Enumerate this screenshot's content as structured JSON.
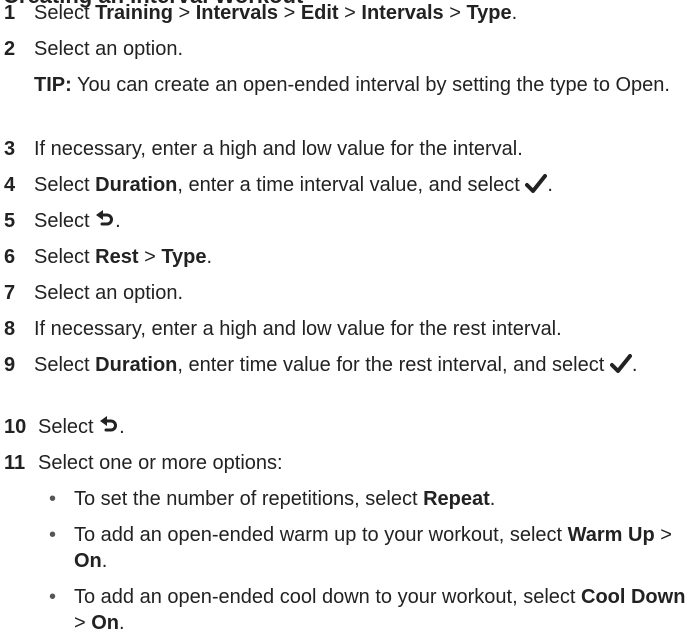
{
  "heading": "Creating an Interval Workout",
  "tip": {
    "label": "TIP:",
    "text": " You can create an open-ended interval by setting the type to Open."
  },
  "steps": {
    "s1": {
      "num": "1",
      "pre": "Select ",
      "b1": "Training",
      "sep1": " > ",
      "b2": "Intervals",
      "sep2": " > ",
      "b3": "Edit",
      "sep3": " > ",
      "b4": "Intervals",
      "sep4": " > ",
      "b5": "Type",
      "post": "."
    },
    "s2": {
      "num": "2",
      "text": "Select an option."
    },
    "s3": {
      "num": "3",
      "text": "If necessary, enter a high and low value for the interval."
    },
    "s4": {
      "num": "4",
      "pre": "Select ",
      "b1": "Duration",
      "post": ", enter a time interval value, and select ",
      "end": "."
    },
    "s5": {
      "num": "5",
      "pre": "Select ",
      "end": "."
    },
    "s6": {
      "num": "6",
      "pre": "Select ",
      "b1": "Rest",
      "sep1": " > ",
      "b2": "Type",
      "post": "."
    },
    "s7": {
      "num": "7",
      "text": "Select an option."
    },
    "s8": {
      "num": "8",
      "text": "If necessary, enter a high and low value for the rest interval."
    },
    "s9": {
      "num": "9",
      "pre": "Select ",
      "b1": "Duration",
      "post": ", enter time value for the rest interval, and select ",
      "end": "."
    },
    "s10": {
      "num": "10",
      "pre": "Select ",
      "end": "."
    },
    "s11": {
      "num": "11",
      "text": "Select one or more options:"
    }
  },
  "bullets": [
    {
      "text": "To set the number of repetitions, select ",
      "b1": "Repeat",
      "post": "."
    },
    {
      "text": "To add an open-ended warm up to your workout, select ",
      "b1": "Warm Up",
      "sep": " > ",
      "b2": "On",
      "post": "."
    },
    {
      "text": "To add an open-ended cool down to your workout, select ",
      "b1": "Cool Down",
      "sep": " > ",
      "b2": "On",
      "post": "."
    }
  ],
  "icons": {
    "confirm": "checkmark-icon",
    "back": "back-arrow-icon"
  },
  "colors": {
    "text": "#222222"
  }
}
